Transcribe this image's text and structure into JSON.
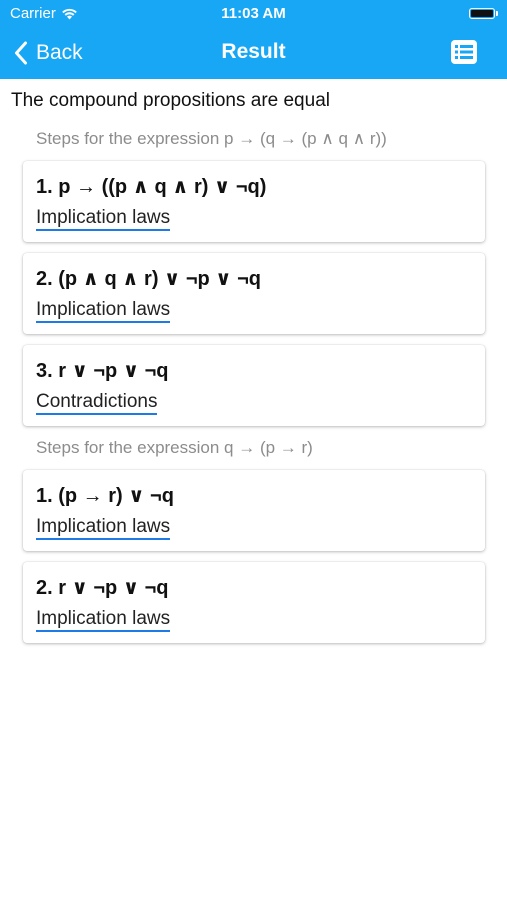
{
  "status": {
    "carrier": "Carrier",
    "time": "11:03 AM"
  },
  "nav": {
    "back_label": "Back",
    "title": "Result"
  },
  "result": {
    "heading": "The compound propositions are equal"
  },
  "sections": [
    {
      "label": "Steps for the expression p → (q → (p ∧ q ∧ r))",
      "steps": [
        {
          "expression": "1. p → ((p ∧ q ∧ r) ∨ ¬q)",
          "law": "Implication laws"
        },
        {
          "expression": "2. (p ∧ q ∧ r) ∨ ¬p ∨ ¬q",
          "law": "Implication laws"
        },
        {
          "expression": "3. r ∨ ¬p ∨ ¬q",
          "law": "Contradictions"
        }
      ]
    },
    {
      "label": "Steps for the expression q → (p → r)",
      "steps": [
        {
          "expression": "1. (p → r) ∨ ¬q",
          "law": "Implication laws"
        },
        {
          "expression": "2. r ∨ ¬p ∨ ¬q",
          "law": "Implication laws"
        }
      ]
    }
  ],
  "icons": {
    "wifi": "wifi-icon",
    "battery": "battery-icon",
    "back": "chevron-left-icon",
    "list": "list-icon"
  },
  "colors": {
    "header_bg": "#17a7f5",
    "link_underline": "#1e7be6",
    "section_label": "#8c8c8c"
  }
}
